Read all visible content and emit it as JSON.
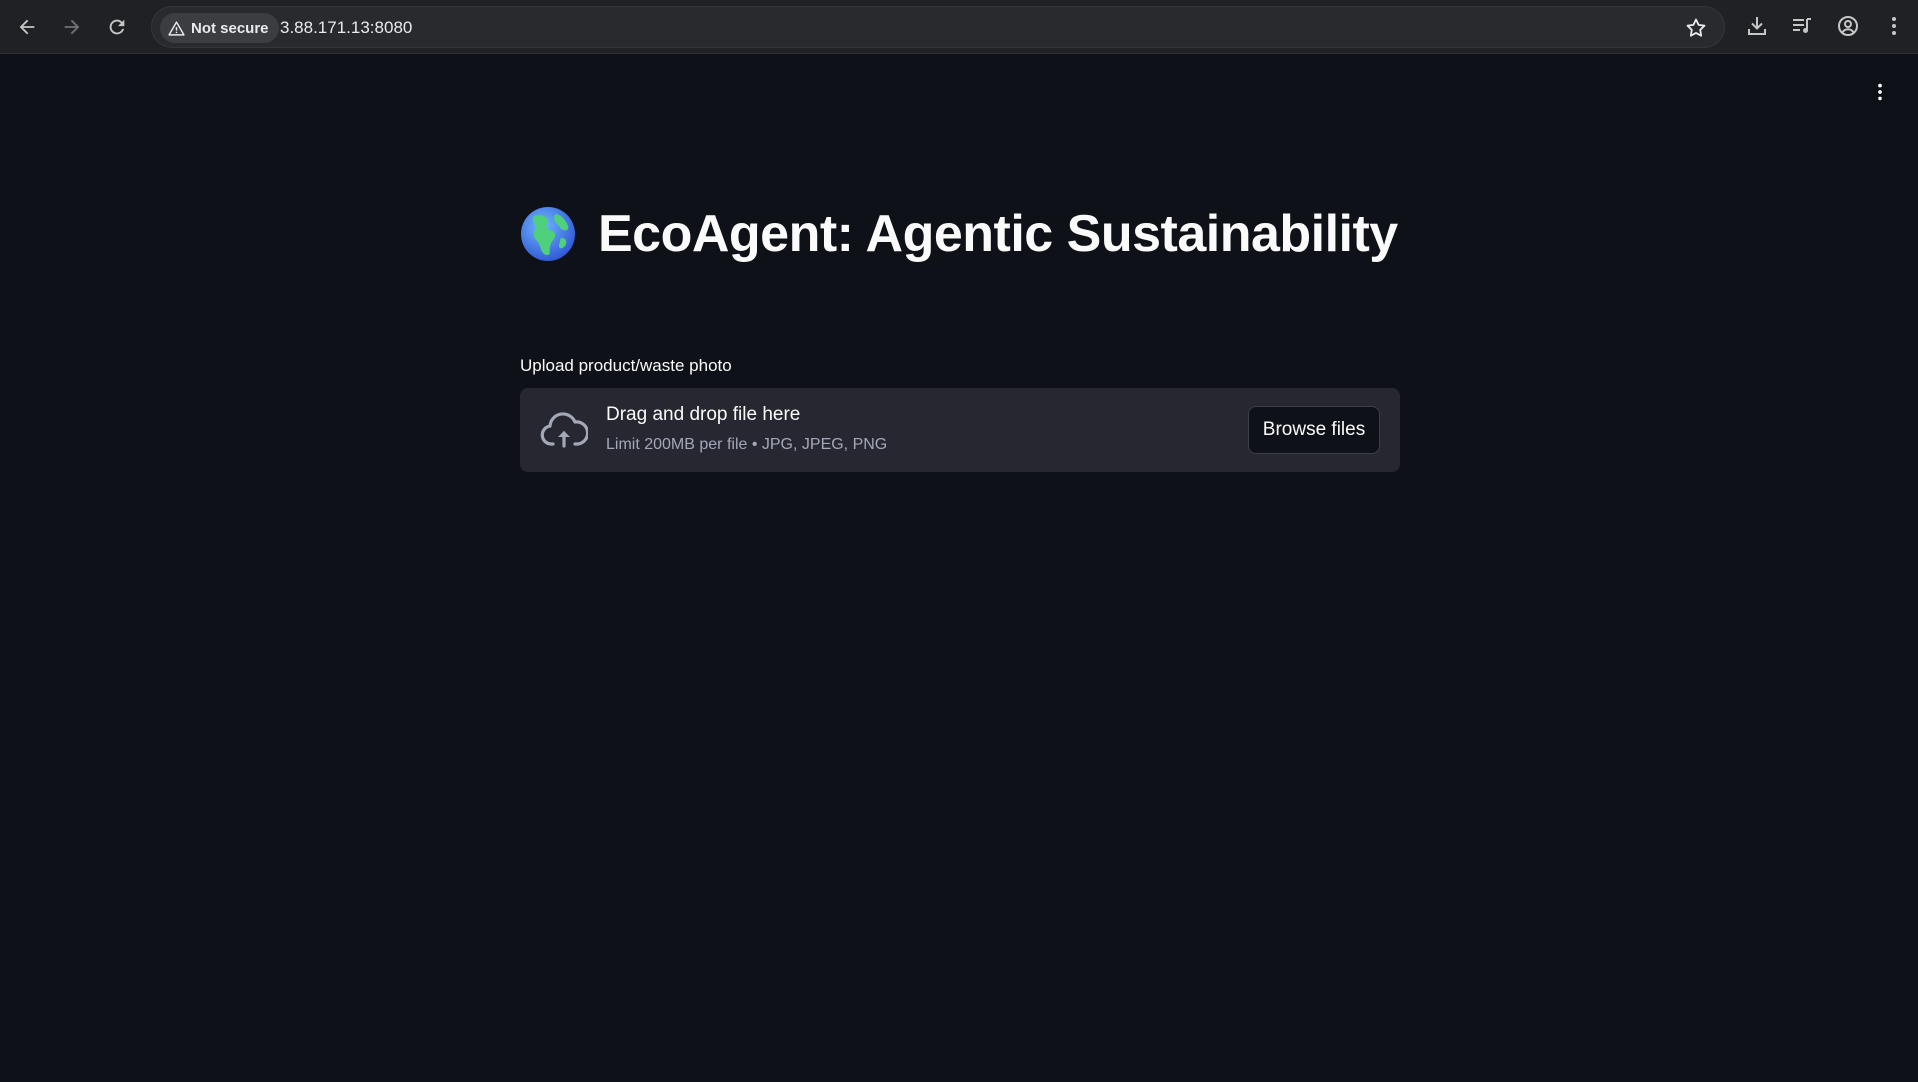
{
  "browser": {
    "security_label": "Not secure",
    "url": "3.88.171.13:8080"
  },
  "icons": {
    "back": "arrow-left-icon",
    "forward": "arrow-right-icon",
    "reload": "reload-icon",
    "warning": "warning-triangle-icon",
    "bookmark": "star-icon",
    "download": "download-icon",
    "media": "media-queue-icon",
    "profile": "profile-icon",
    "browser_menu": "kebab-menu-icon",
    "app_menu": "kebab-menu-icon",
    "globe": "globe-emoji-icon",
    "upload": "cloud-upload-icon"
  },
  "app": {
    "title": "EcoAgent: Agentic Sustainability"
  },
  "uploader": {
    "label": "Upload product/waste photo",
    "dropzone_title": "Drag and drop file here",
    "dropzone_subtitle": "Limit 200MB per file • JPG, JPEG, PNG",
    "browse_label": "Browse files"
  },
  "colors": {
    "page_background": "#0e1117",
    "dropzone_background": "#262730",
    "browser_bar": "#202124",
    "text": "#fafafa",
    "muted_text": "#a3a8b8"
  }
}
